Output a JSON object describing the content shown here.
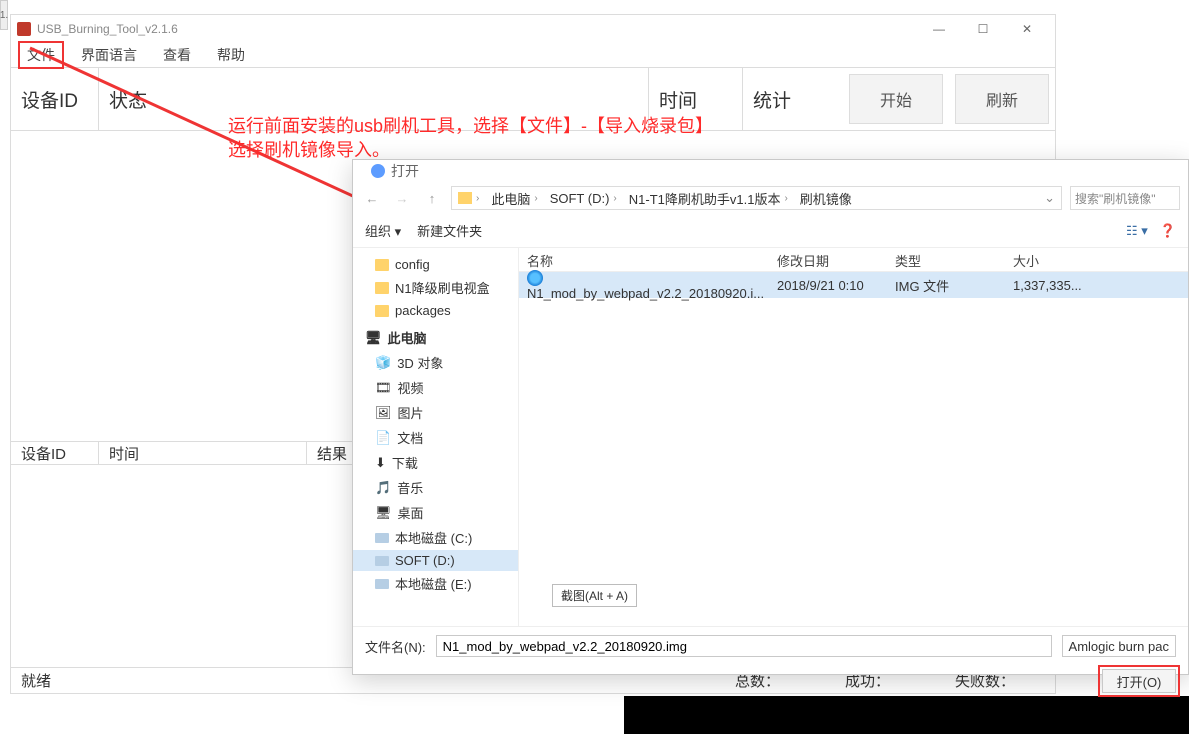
{
  "burn": {
    "title": "USB_Burning_Tool_v2.1.6",
    "menu": {
      "file": "文件",
      "lang": "界面语言",
      "view": "查看",
      "help": "帮助"
    },
    "cols": {
      "devid": "设备ID",
      "state": "状态",
      "time": "时间",
      "stat": "统计"
    },
    "cols2": {
      "devid": "设备ID",
      "time": "时间",
      "result": "结果"
    },
    "btn_start": "开始",
    "btn_refresh": "刷新",
    "status": {
      "ready": "就绪",
      "total": "总数：",
      "succ": "成功：",
      "fail": "失败数："
    }
  },
  "anno": {
    "line1": "运行前面安装的usb刷机工具，选择【文件】-【导入烧录包】",
    "line2": "选择刷机镜像导入。"
  },
  "dlg": {
    "title": "打开",
    "crumbs": [
      "此电脑",
      "SOFT (D:)",
      "N1-T1降刷机助手v1.1版本",
      "刷机镜像"
    ],
    "search_ph": "搜索\"刷机镜像\"",
    "organize": "组织",
    "newfolder": "新建文件夹",
    "tree": {
      "config": "config",
      "n1box": "N1降级刷电视盒",
      "packages": "packages",
      "thispc": "此电脑",
      "obj3d": "3D 对象",
      "video": "视频",
      "pic": "图片",
      "doc": "文档",
      "dl": "下载",
      "music": "音乐",
      "desktop": "桌面",
      "cdisk": "本地磁盘 (C:)",
      "ddisk": "SOFT (D:)",
      "edisk": "本地磁盘 (E:)"
    },
    "headers": {
      "name": "名称",
      "date": "修改日期",
      "type": "类型",
      "size": "大小"
    },
    "row": {
      "name": "N1_mod_by_webpad_v2.2_20180920.i...",
      "date": "2018/9/21 0:10",
      "type": "IMG 文件",
      "size": "1,337,335..."
    },
    "tip": "截图(Alt + A)",
    "filename_label": "文件名(N):",
    "filename_value": "N1_mod_by_webpad_v2.2_20180920.img",
    "filter": "Amlogic burn pac",
    "open": "打开(O)"
  }
}
